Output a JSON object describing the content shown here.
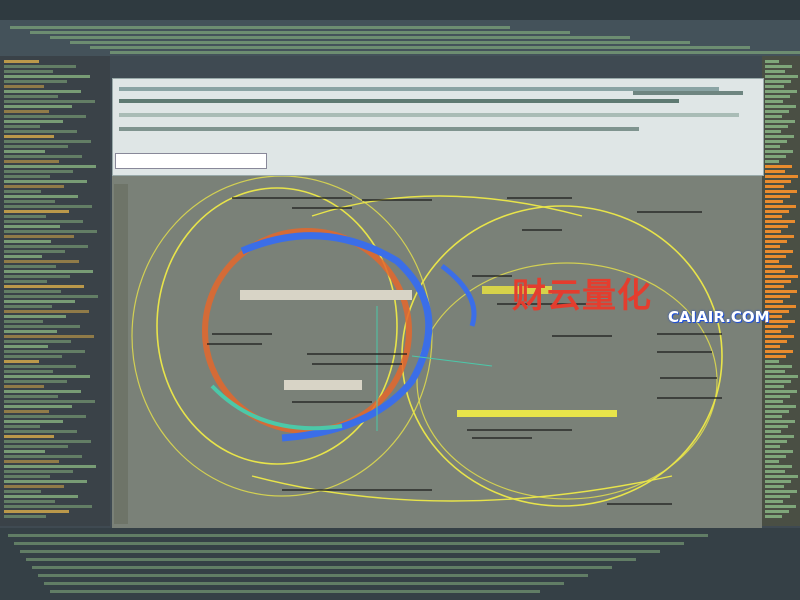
{
  "watermark": {
    "cn": "财云量化",
    "en": "CAIAIR.COM"
  },
  "colors": {
    "panel": "#7a8178",
    "ring_yellow": "#e8e44a",
    "ring_blue": "#3b6ee8",
    "ring_orange": "#e4672b",
    "ring_teal": "#4cc8a8",
    "code_green": "#7fa67a",
    "pane_orange": "#e98b2d"
  },
  "icons": [
    "grid-icon"
  ]
}
